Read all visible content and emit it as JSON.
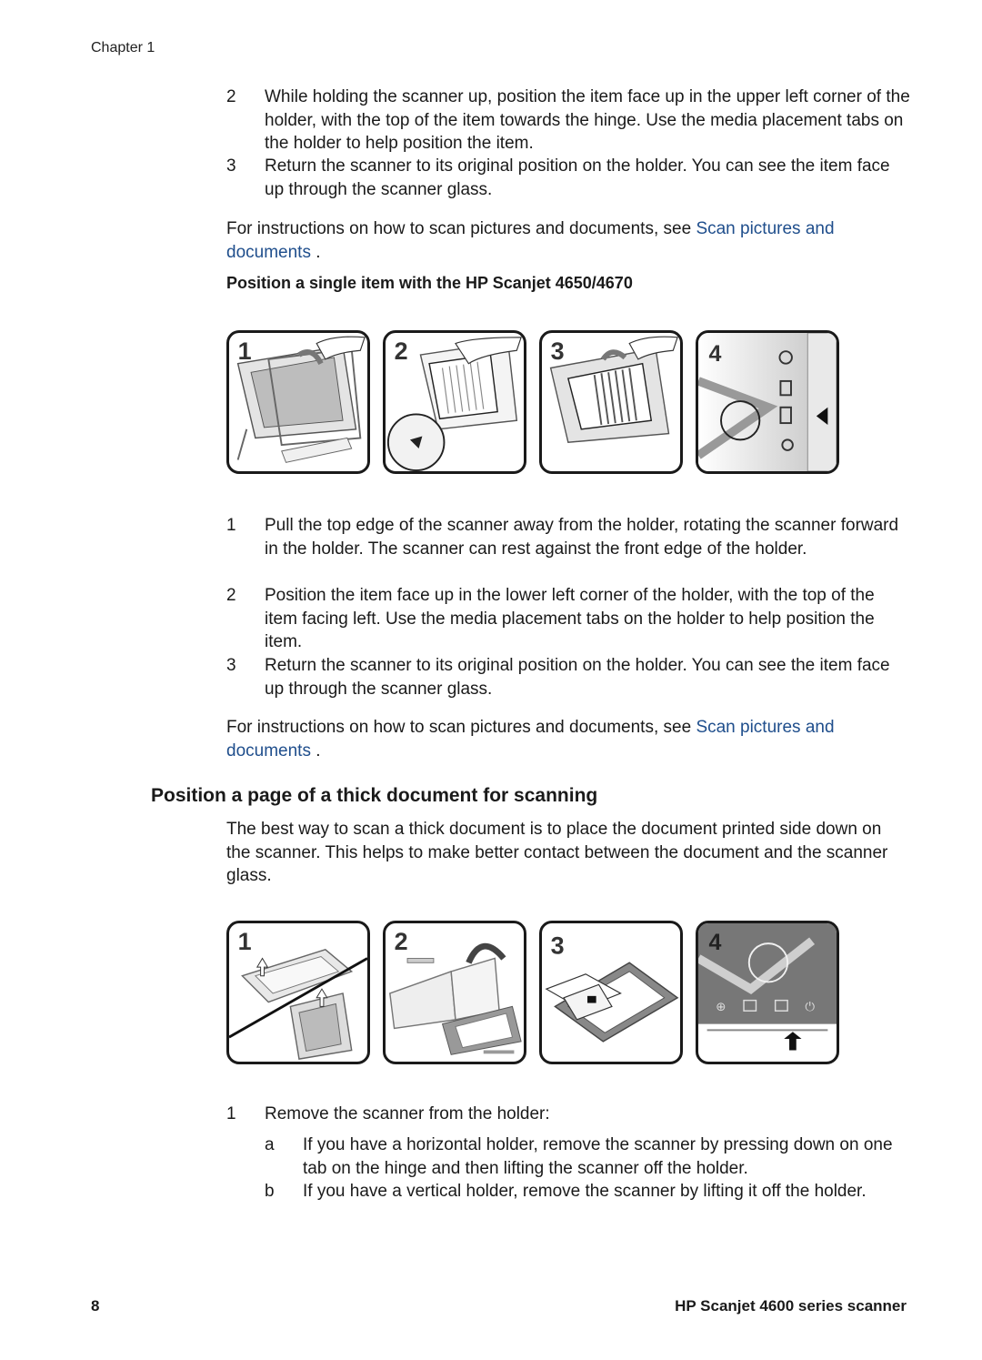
{
  "header": {
    "chapter": "Chapter 1"
  },
  "intro_steps": [
    {
      "num": "2",
      "text": "While holding the scanner up, position the item face up in the upper left corner of the holder, with the top of the item towards the hinge. Use the media placement tabs on the holder to help position the item."
    },
    {
      "num": "3",
      "text": "Return the scanner to its original position on the holder. You can see the item face up through the scanner glass."
    }
  ],
  "instructions_1": {
    "prefix": "For instructions on how to scan pictures and documents, see ",
    "link": "Scan pictures and documents",
    "suffix": " ."
  },
  "subheading": "Position a single item with the HP Scanjet 4650/4670",
  "figure1": {
    "panels": [
      {
        "label": "1",
        "icon": "rotate-scanner-forward-illustration"
      },
      {
        "label": "2",
        "icon": "place-item-lower-left-illustration"
      },
      {
        "label": "3",
        "icon": "return-scanner-illustration"
      },
      {
        "label": "4",
        "icon": "scanner-buttons-illustration"
      }
    ]
  },
  "single_item_steps": [
    {
      "num": "1",
      "text": "Pull the top edge of the scanner away from the holder, rotating the scanner forward in the holder. The scanner can rest against the front edge of the holder."
    },
    {
      "num": "2",
      "text": "Position the item face up in the lower left corner of the holder, with the top of the item facing left. Use the media placement tabs on the holder to help position the item."
    },
    {
      "num": "3",
      "text": "Return the scanner to its original position on the holder. You can see the item face up through the scanner glass."
    }
  ],
  "instructions_2": {
    "prefix": "For instructions on how to scan pictures and documents, see ",
    "link": "Scan pictures and documents",
    "suffix": " ."
  },
  "section_heading": "Position a page of a thick document for scanning",
  "section_intro": "The best way to scan a thick document is to place the document printed side down on the scanner. This helps to make better contact between the document and the scanner glass.",
  "figure2": {
    "panels": [
      {
        "label": "1",
        "icon": "remove-scanner-from-holder-illustration"
      },
      {
        "label": "2",
        "icon": "flip-scanner-illustration"
      },
      {
        "label": "3",
        "icon": "place-document-illustration"
      },
      {
        "label": "4",
        "icon": "press-scan-button-illustration"
      }
    ]
  },
  "thick_steps": [
    {
      "num": "1",
      "text": "Remove the scanner from the holder:"
    }
  ],
  "thick_substeps": [
    {
      "num": "a",
      "text": "If you have a horizontal holder, remove the scanner by pressing down on one tab on the hinge and then lifting the scanner off the holder."
    },
    {
      "num": "b",
      "text": "If you have a vertical holder, remove the scanner by lifting it off the holder."
    }
  ],
  "footer": {
    "page_number": "8",
    "product": "HP Scanjet 4600 series scanner"
  },
  "colors": {
    "link": "#1f4e8c",
    "text": "#1a1a1a"
  }
}
